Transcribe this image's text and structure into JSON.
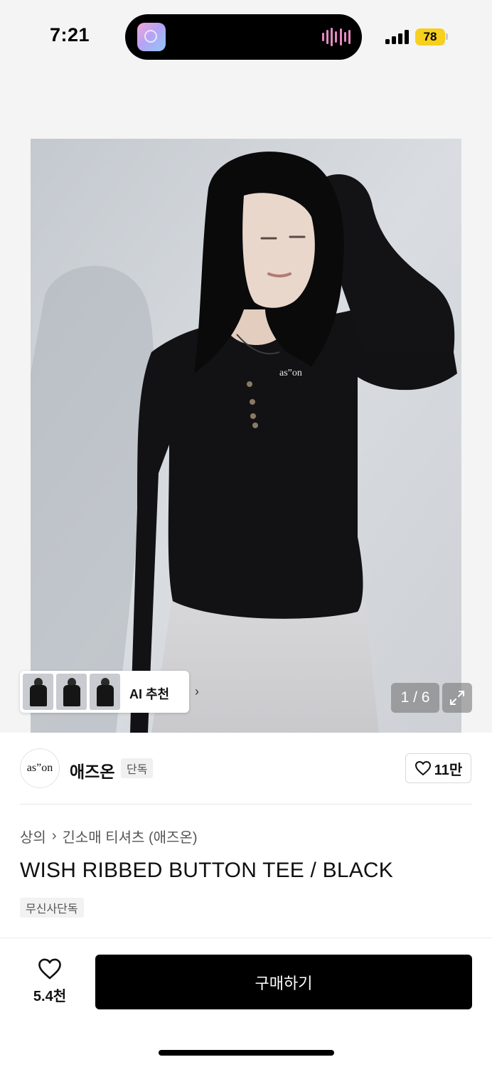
{
  "status_bar": {
    "time": "7:21",
    "battery": "78"
  },
  "gallery": {
    "pager": "1 / 6",
    "ai_recommend_label": "AI 추천",
    "photo_print": "as”on"
  },
  "brand": {
    "logo_text": "as”on",
    "name": "애즈온",
    "badge": "단독",
    "like_count": "11만"
  },
  "breadcrumb": {
    "category": "상의",
    "subcategory": "긴소매 티셔츠 (애즈온)"
  },
  "product": {
    "title": "WISH RIBBED BUTTON TEE / BLACK",
    "tag": "무신사단독"
  },
  "bottom_bar": {
    "wish_count": "5.4천",
    "buy_label": "구매하기"
  },
  "colors": {
    "accent": "#000000",
    "battery": "#f7cf1e",
    "island_wave": "#e48ac0"
  },
  "icons": [
    "app-icon",
    "audio-wave-icon",
    "signal-icon",
    "battery-icon",
    "chevron-right-icon",
    "expand-icon",
    "heart-icon"
  ]
}
